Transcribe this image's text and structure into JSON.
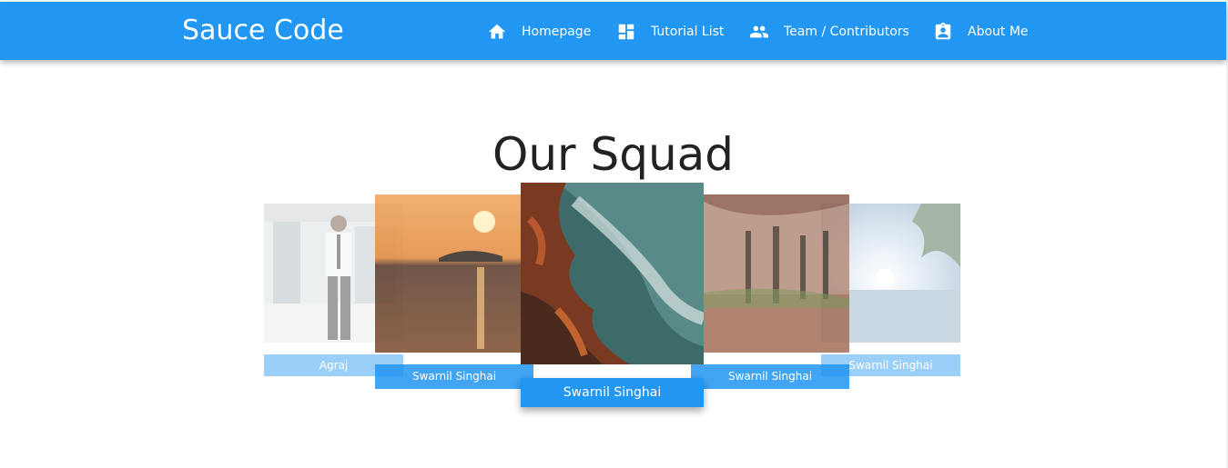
{
  "app": {
    "brand": "Sauce Code",
    "accent_color": "#2196f3"
  },
  "nav": {
    "items": [
      {
        "label": "Homepage",
        "icon": "home-icon"
      },
      {
        "label": "Tutorial List",
        "icon": "dashboard-icon"
      },
      {
        "label": "Team / Contributors",
        "icon": "people-icon"
      },
      {
        "label": "About Me",
        "icon": "assignment-ind-icon"
      }
    ]
  },
  "page": {
    "title": "Our Squad"
  },
  "carousel": {
    "cards": [
      {
        "name": "Agraj",
        "photo": "person-standing-photo"
      },
      {
        "name": "Swarnil Singhai",
        "photo": "sunset-lake-photo"
      },
      {
        "name": "Swarnil Singhai",
        "photo": "rocky-coast-photo"
      },
      {
        "name": "Swarnil Singhai",
        "photo": "autumn-trees-photo"
      },
      {
        "name": "Swarnil Singhai",
        "photo": "palm-sunrise-photo"
      }
    ]
  }
}
